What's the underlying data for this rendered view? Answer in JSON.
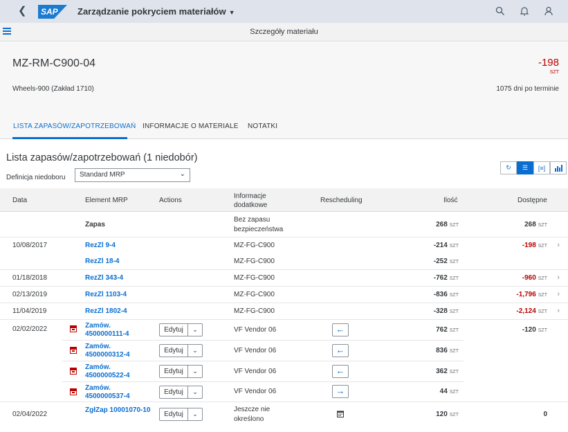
{
  "shell": {
    "app_title": "Zarządzanie pokryciem materiałów",
    "logo": "SAP",
    "icons": [
      "back-icon",
      "search-icon",
      "bell-icon",
      "user-icon"
    ]
  },
  "subbar": {
    "title": "Szczegóły materiału"
  },
  "header": {
    "material_id": "MZ-RM-C900-04",
    "description": "Wheels-900 (Zakład 1710)",
    "kpi_value": "-198",
    "kpi_unit": "SZT",
    "days_late": "1075 dni po terminie"
  },
  "tabs": [
    {
      "label": "LISTA ZAPASÓW/ZAPOTRZEBOWAŃ"
    },
    {
      "label": "INFORMACJE O MATERIALE"
    },
    {
      "label": "NOTATKI"
    }
  ],
  "list": {
    "title": "Lista zapasów/zapotrzebowań (1 niedobór)",
    "def_label": "Definicja niedoboru",
    "def_value": "Standard MRP"
  },
  "columns": {
    "date": "Data",
    "element": "Element MRP",
    "actions": "Actions",
    "info": "Informacje dodatkowe",
    "resched": "Rescheduling",
    "qty": "Ilość",
    "avail": "Dostępne"
  },
  "colors": {
    "accent": "#0a6ed1",
    "negative": "#bb0000",
    "shell": "#dfe4ec"
  },
  "rows": [
    {
      "date": "",
      "element": "Zapas",
      "info": "Bez zapasu bezpieczeństwa",
      "qty": "268",
      "avail": "268",
      "unit": "SZT"
    },
    {
      "date": "10/08/2017",
      "element": "RezZl 9-4",
      "info": "MZ-FG-C900",
      "qty": "-214",
      "avail": "-198",
      "unit": "SZT"
    },
    {
      "date": "",
      "element": "RezZl 18-4",
      "info": "MZ-FG-C900",
      "qty": "-252",
      "avail": "",
      "unit": "SZT"
    },
    {
      "date": "01/18/2018",
      "element": "RezZl 343-4",
      "info": "MZ-FG-C900",
      "qty": "-762",
      "avail": "-960",
      "unit": "SZT"
    },
    {
      "date": "02/13/2019",
      "element": "RezZl 1103-4",
      "info": "MZ-FG-C900",
      "qty": "-836",
      "avail": "-1,796",
      "unit": "SZT"
    },
    {
      "date": "11/04/2019",
      "element": "RezZl 1802-4",
      "info": "MZ-FG-C900",
      "qty": "-328",
      "avail": "-2,124",
      "unit": "SZT"
    },
    {
      "date": "02/02/2022",
      "element": "Zamów. 4500000111-4",
      "action": "Edytuj",
      "info": "VF Vendor 06",
      "qty": "762",
      "avail": "-120",
      "unit": "SZT",
      "resched": "←"
    },
    {
      "date": "",
      "element": "Zamów. 4500000312-4",
      "action": "Edytuj",
      "info": "VF Vendor 06",
      "qty": "836",
      "avail": "",
      "unit": "SZT",
      "resched": "←"
    },
    {
      "date": "",
      "element": "Zamów. 4500000522-4",
      "action": "Edytuj",
      "info": "VF Vendor 06",
      "qty": "362",
      "avail": "",
      "unit": "SZT",
      "resched": "←"
    },
    {
      "date": "",
      "element": "Zamów. 4500000537-4",
      "action": "Edytuj",
      "info": "VF Vendor 06",
      "qty": "44",
      "avail": "",
      "unit": "SZT",
      "resched": "→"
    },
    {
      "date": "02/04/2022",
      "element": "ZgłZap 10001070-10",
      "action": "Edytuj",
      "info": "Jeszcze nie określono",
      "qty": "120",
      "avail": "0",
      "unit": "SZT",
      "resched": ""
    }
  ]
}
